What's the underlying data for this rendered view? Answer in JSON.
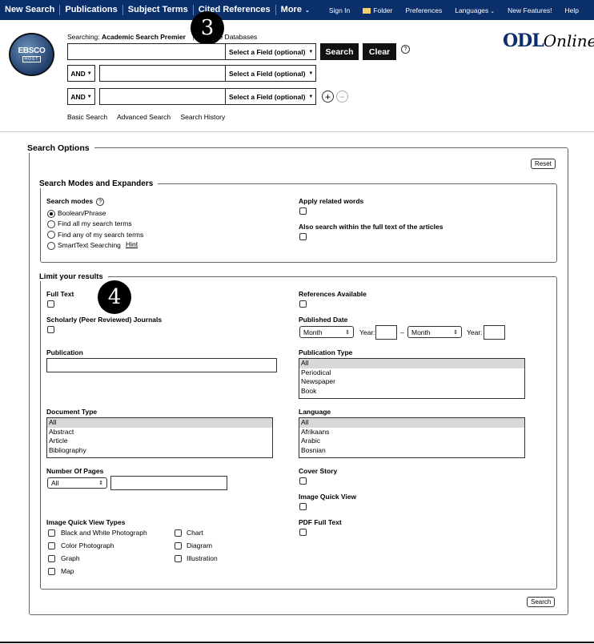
{
  "topbar": {
    "main_nav": [
      "New Search",
      "Publications",
      "Subject Terms",
      "Cited References"
    ],
    "more_label": "More",
    "secondary_nav": {
      "sign_in": "Sign In",
      "folder": "Folder",
      "preferences": "Preferences",
      "languages": "Languages",
      "new_features": "New Features!",
      "help": "Help"
    }
  },
  "logo": {
    "line1": "EBSCO",
    "line2": "HOST"
  },
  "searching": {
    "prefix": "Searching:",
    "database": "Academic Search Premier",
    "choose": "Choose Databases"
  },
  "badges": {
    "b3": "3",
    "b4": "4"
  },
  "odl": {
    "bold": "ODL",
    "italic": "Online"
  },
  "search": {
    "field_select": "Select a Field (optional)",
    "bool_op": "AND",
    "search_btn": "Search",
    "clear_btn": "Clear",
    "help": "?",
    "add": "+",
    "remove": "−"
  },
  "links": {
    "basic": "Basic Search",
    "advanced": "Advanced Search",
    "history": "Search History"
  },
  "options": {
    "title": "Search Options",
    "reset": "Reset",
    "modes_title": "Search Modes and Expanders",
    "modes_label": "Search modes",
    "modes": [
      "Boolean/Phrase",
      "Find all my search terms",
      "Find any of my search terms",
      "SmartText Searching"
    ],
    "hint": "Hint",
    "apply_related": "Apply related words",
    "full_text_search": "Also search within the full text of the articles",
    "limit_title": "Limit your results",
    "full_text": "Full Text",
    "references": "References Available",
    "scholarly": "Scholarly (Peer Reviewed) Journals",
    "published_date": "Published Date",
    "month": "Month",
    "year": "Year:",
    "dash": "–",
    "publication": "Publication",
    "publication_type": "Publication Type",
    "publication_types": [
      "All",
      "Periodical",
      "Newspaper",
      "Book"
    ],
    "document_type": "Document Type",
    "document_types": [
      "All",
      "Abstract",
      "Article",
      "Bibliography"
    ],
    "language": "Language",
    "languages": [
      "All",
      "Afrikaans",
      "Arabic",
      "Bosnian"
    ],
    "pages": "Number Of Pages",
    "pages_sel": "All",
    "cover_story": "Cover Story",
    "image_quick_view": "Image Quick View",
    "pdf_full_text": "PDF Full Text",
    "iqv_types": "Image Quick View Types",
    "iqv_left": [
      "Black and White Photograph",
      "Color Photograph",
      "Graph",
      "Map"
    ],
    "iqv_right": [
      "Chart",
      "Diagram",
      "Illustration"
    ],
    "search_btn": "Search"
  }
}
